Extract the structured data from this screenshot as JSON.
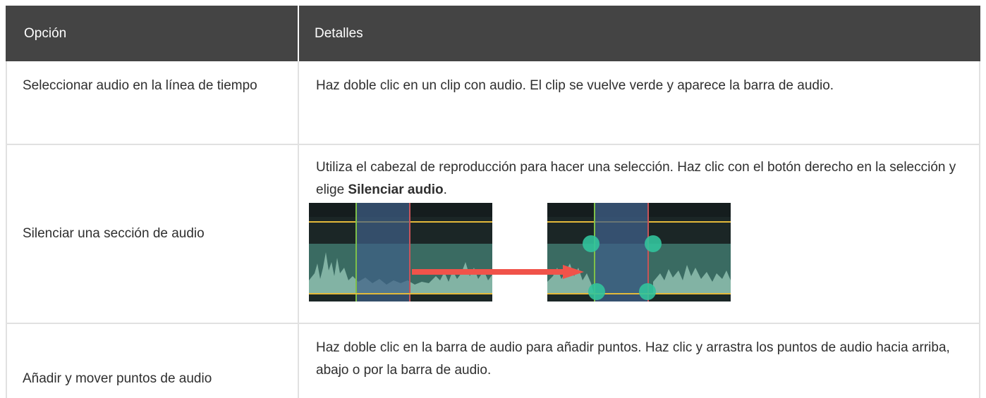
{
  "table": {
    "headers": [
      "Opción",
      "Detalles"
    ],
    "rows": [
      {
        "option": "Seleccionar audio en la línea de tiempo",
        "details": "Haz doble clic en un clip con audio. El clip se vuelve verde y aparece la barra de audio."
      },
      {
        "option": "Silenciar una sección de audio",
        "details_before": "Utiliza el cabezal de reproducción para hacer una selección. Haz clic con el botón derecho en la selección y elige ",
        "details_bold": "Silenciar audio",
        "details_after": "."
      },
      {
        "option": "Añadir y mover puntos de audio",
        "details": "Haz doble clic en la barra de audio para añadir puntos. Haz clic y arrastra los puntos de audio hacia arriba, abajo o por la barra de audio."
      }
    ]
  },
  "colors": {
    "header_bg": "#444444",
    "border": "#e1e1e1",
    "track_bg": "#1d2a2a",
    "waveform": "#8fc0b0",
    "selection": "#3f5f88",
    "playhead_green": "#7ec04a",
    "playhead_red": "#c7545a",
    "line_yellow": "#e4b93a",
    "arrow": "#f0534a",
    "point": "#32c39c"
  }
}
